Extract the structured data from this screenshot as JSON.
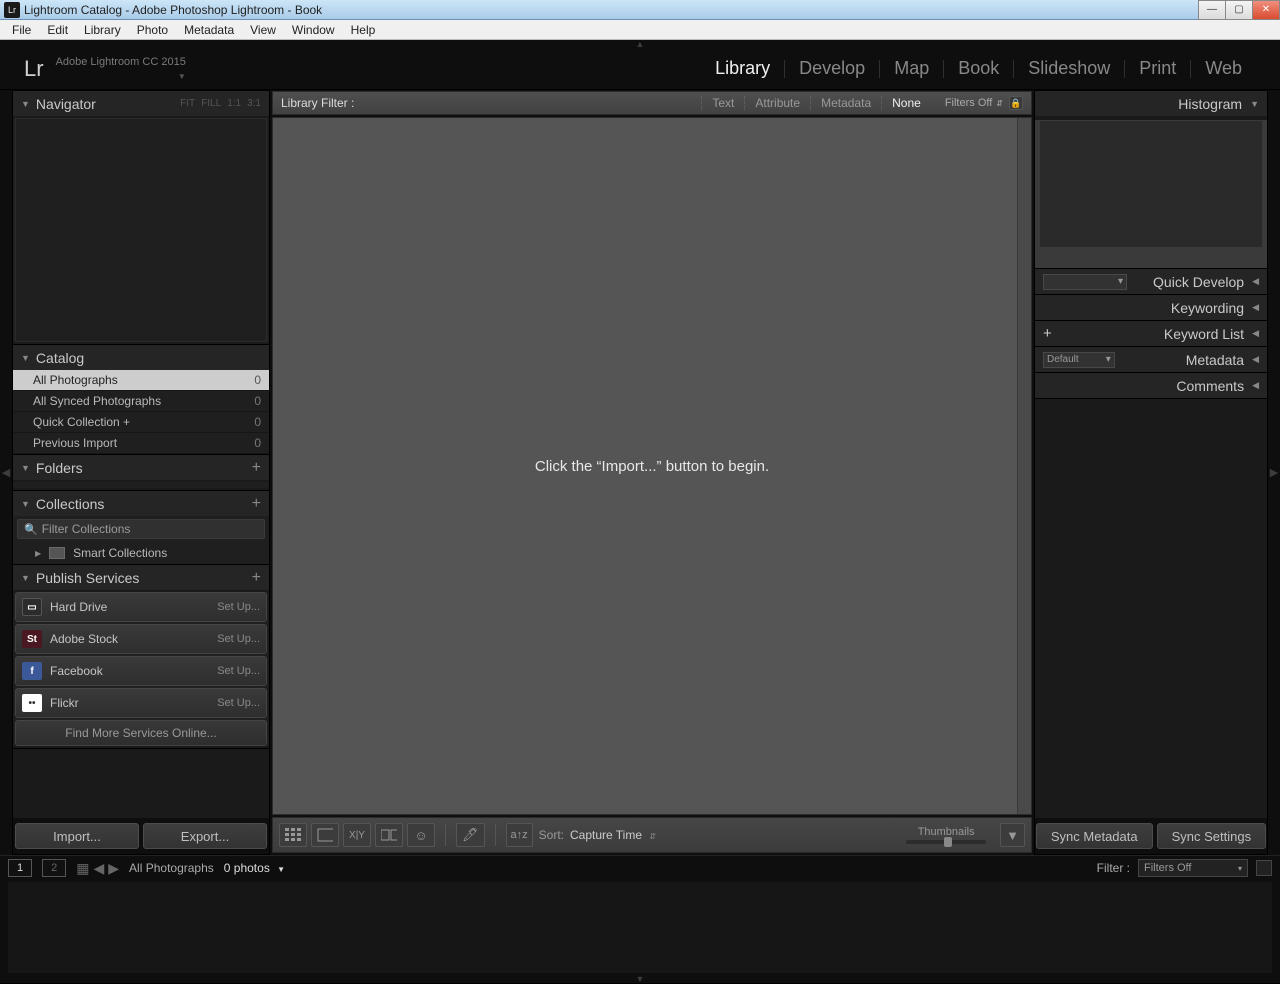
{
  "window": {
    "title": "Lightroom Catalog - Adobe Photoshop Lightroom - Book",
    "icon": "Lr"
  },
  "menubar": [
    "File",
    "Edit",
    "Library",
    "Photo",
    "Metadata",
    "View",
    "Window",
    "Help"
  ],
  "identity": {
    "logo": "Lr",
    "version": "Adobe Lightroom CC 2015"
  },
  "modules": [
    {
      "label": "Library",
      "active": true
    },
    {
      "label": "Develop",
      "active": false
    },
    {
      "label": "Map",
      "active": false
    },
    {
      "label": "Book",
      "active": false
    },
    {
      "label": "Slideshow",
      "active": false
    },
    {
      "label": "Print",
      "active": false
    },
    {
      "label": "Web",
      "active": false
    }
  ],
  "navigator": {
    "title": "Navigator",
    "zooms": [
      "FIT",
      "FILL",
      "1:1",
      "3:1"
    ]
  },
  "catalog": {
    "title": "Catalog",
    "items": [
      {
        "label": "All Photographs",
        "count": 0,
        "selected": true
      },
      {
        "label": "All Synced Photographs",
        "count": 0,
        "selected": false
      },
      {
        "label": "Quick Collection  +",
        "count": 0,
        "selected": false
      },
      {
        "label": "Previous Import",
        "count": 0,
        "selected": false
      }
    ]
  },
  "folders": {
    "title": "Folders"
  },
  "collections": {
    "title": "Collections",
    "filter_placeholder": "Filter Collections",
    "smart": "Smart Collections"
  },
  "publish": {
    "title": "Publish Services",
    "setup": "Set Up...",
    "services": [
      {
        "label": "Hard Drive",
        "class": "hd",
        "ic": "▭"
      },
      {
        "label": "Adobe Stock",
        "class": "st",
        "ic": "St"
      },
      {
        "label": "Facebook",
        "class": "fb",
        "ic": "f"
      },
      {
        "label": "Flickr",
        "class": "fl",
        "ic": "••"
      }
    ],
    "findmore": "Find More Services Online..."
  },
  "actions": {
    "import": "Import...",
    "export": "Export..."
  },
  "libfilter": {
    "label": "Library Filter :",
    "options": [
      "Text",
      "Attribute",
      "Metadata",
      "None"
    ],
    "active": "None",
    "filters_off": "Filters Off"
  },
  "grid": {
    "empty": "Click the “Import...” button to begin."
  },
  "toolbar": {
    "sort_label": "Sort:",
    "sort_value": "Capture Time",
    "thumbnails": "Thumbnails"
  },
  "right_panels": {
    "histogram": "Histogram",
    "quick_develop": "Quick Develop",
    "keywording": "Keywording",
    "keyword_list": "Keyword List",
    "metadata": "Metadata",
    "metadata_preset": "Default",
    "comments": "Comments"
  },
  "right_actions": {
    "sync_meta": "Sync Metadata",
    "sync_settings": "Sync Settings"
  },
  "filmstrip": {
    "source": "All Photographs",
    "count": "0 photos",
    "filter_label": "Filter :",
    "filter_value": "Filters Off",
    "m1": "1",
    "m2": "2"
  }
}
